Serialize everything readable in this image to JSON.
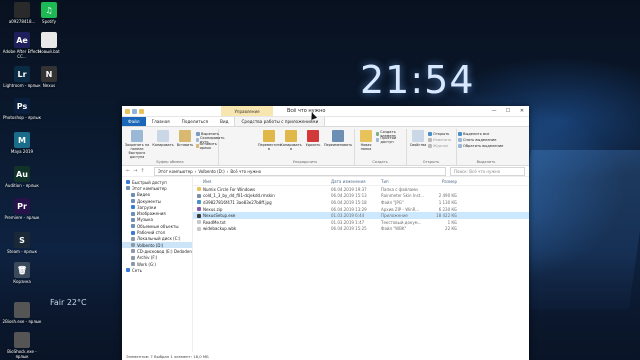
{
  "desktop": {
    "clock": "21:54",
    "weather": "Fair 22°C",
    "icons": [
      {
        "label": "a09278418...",
        "abbr": "",
        "color": "#2a2a2a"
      },
      {
        "label": "Spotify",
        "abbr": "♫",
        "color": "#1db954"
      },
      {
        "label": "Adobe After Effects CC...",
        "abbr": "Ae",
        "color": "#1f1f5c"
      },
      {
        "label": "Новый.bat",
        "abbr": "",
        "color": "#e8e8e8"
      },
      {
        "label": "Lightroom - ярлык",
        "abbr": "Lr",
        "color": "#0b2a44"
      },
      {
        "label": "Nexus",
        "abbr": "N",
        "color": "#333"
      },
      {
        "label": "Photoshop - ярлык",
        "abbr": "Ps",
        "color": "#0a1f3d"
      },
      {
        "label": "Maya 2019",
        "abbr": "M",
        "color": "#1a6d8a"
      },
      {
        "label": "Audition - ярлык",
        "abbr": "Au",
        "color": "#103228"
      },
      {
        "label": "Premiere - ярлык",
        "abbr": "Pr",
        "color": "#27124a"
      },
      {
        "label": "Steam - ярлык",
        "abbr": "S",
        "color": "#1b2838"
      },
      {
        "label": "Корзина",
        "abbr": "🗑",
        "color": "#3a4a5a"
      },
      {
        "label": "2Biosh.exe - ярлык",
        "abbr": "",
        "color": "#555"
      },
      {
        "label": "BioShock.exe - ярлык",
        "abbr": "",
        "color": "#555"
      }
    ]
  },
  "window": {
    "context_tab": "Управление",
    "title": "Всё что нужно",
    "controls": {
      "minimize": "—",
      "maximize": "☐",
      "close": "✕"
    },
    "tabs": [
      "Файл",
      "Главная",
      "Поделиться",
      "Вид",
      "Средства работы с приложениями"
    ],
    "ribbon": {
      "clipboard": {
        "label": "Буфер обмена",
        "pin": "Закрепить на панели быстрого доступа",
        "copy": "Копировать",
        "paste": "Вставить",
        "cut": "Вырезать",
        "copy_path": "Скопировать путь",
        "paste_shortcut": "Вставить ярлык"
      },
      "organize": {
        "label": "Упорядочить",
        "move": "Переместить в",
        "copy_to": "Копировать в",
        "delete": "Удалить",
        "rename": "Переименовать"
      },
      "create": {
        "label": "Создать",
        "new_folder": "Новая папка",
        "new_item": "Создать элемент",
        "easy_access": "Простой доступ"
      },
      "open": {
        "label": "Открыть",
        "properties": "Свойства",
        "open": "Открыть",
        "edit": "Изменить",
        "history": "Журнал"
      },
      "select": {
        "label": "Выделить",
        "select_all": "Выделить все",
        "select_none": "Снять выделение",
        "invert": "Обратить выделение"
      }
    },
    "address": {
      "back": "←",
      "forward": "→",
      "up": "↑",
      "path": [
        "Этот компьютер",
        "Volbento (D:)",
        "Всё что нужно"
      ],
      "search_placeholder": "Поиск: Всё что нужно"
    },
    "nav_pane": [
      {
        "label": "Быстрый доступ",
        "indent": 0,
        "color": "#3a7bd5"
      },
      {
        "label": "Этот компьютер",
        "indent": 0,
        "color": "#6b8fb5"
      },
      {
        "label": "Видео",
        "indent": 1,
        "color": "#6b8fb5"
      },
      {
        "label": "Документы",
        "indent": 1,
        "color": "#6b8fb5"
      },
      {
        "label": "Загрузки",
        "indent": 1,
        "color": "#3a7bd5"
      },
      {
        "label": "Изображения",
        "indent": 1,
        "color": "#6b8fb5"
      },
      {
        "label": "Музыка",
        "indent": 1,
        "color": "#6b8fb5"
      },
      {
        "label": "Объемные объекты",
        "indent": 1,
        "color": "#6b8fb5"
      },
      {
        "label": "Рабочий стол",
        "indent": 1,
        "color": "#3a7bd5"
      },
      {
        "label": "Локальный диск (C:)",
        "indent": 1,
        "color": "#8c9aa8"
      },
      {
        "label": "Volbento (D:)",
        "indent": 1,
        "color": "#8c9aa8",
        "selected": true
      },
      {
        "label": "CD-дисковод (E:) Dedoden",
        "indent": 1,
        "color": "#8c9aa8"
      },
      {
        "label": "Archiv (F:)",
        "indent": 1,
        "color": "#8c9aa8"
      },
      {
        "label": "Work (G:)",
        "indent": 1,
        "color": "#8c9aa8"
      },
      {
        "label": "Сеть",
        "indent": 0,
        "color": "#3a7bd5"
      }
    ],
    "columns": {
      "name": "Имя",
      "date": "Дата изменения",
      "type": "Тип",
      "size": "Размер"
    },
    "files": [
      {
        "name": "Numix Circle For Windows",
        "date": "06.04.2019 19:37",
        "type": "Папка с файлами",
        "size": "",
        "color": "#e8c25a"
      },
      {
        "name": "cold_1_3_by_dd_f01-dcjekdd.rmskin",
        "date": "06.04.2019 15:13",
        "type": "Rainmeter Skin Inst...",
        "size": "2 490 КБ",
        "color": "#7a8fa8"
      },
      {
        "name": "d39827816f471 3ae83e27b8ff.jpg",
        "date": "06.04.2019 15:18",
        "type": "Файл \"JPG\"",
        "size": "1 130 КБ",
        "color": "#4a90c8"
      },
      {
        "name": "Nexus.zip",
        "date": "06.04.2019 13:29",
        "type": "Архив ZIP - WinR...",
        "size": "6 230 КБ",
        "color": "#8a5aa8"
      },
      {
        "name": "NexusSetup.exe",
        "date": "01.03.2019 6:44",
        "type": "Приложение",
        "size": "18 422 КБ",
        "color": "#3a3a3a",
        "selected": true
      },
      {
        "name": "ReadMe.txt",
        "date": "01.03.2019 1:47",
        "type": "Текстовый докум...",
        "size": "1 КБ",
        "color": "#c8c8c8"
      },
      {
        "name": "widebackup.wbk",
        "date": "06.04.2019 15:25",
        "type": "Файл \"WBK\"",
        "size": "22 КБ",
        "color": "#c8c8c8"
      }
    ],
    "status": "Элементов: 7    Выбран 1 элемент: 18,0 МБ"
  }
}
